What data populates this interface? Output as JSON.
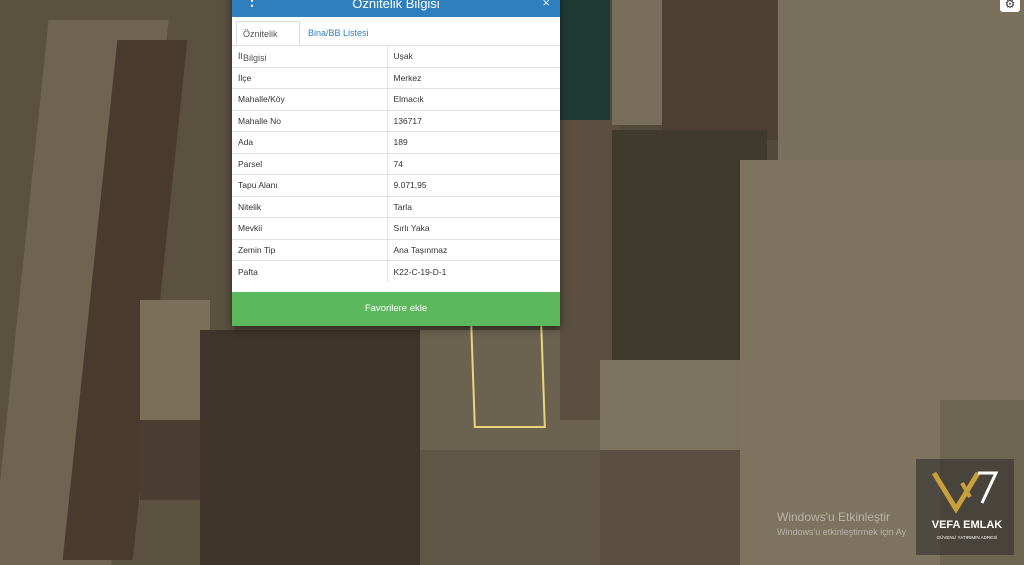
{
  "panel": {
    "title": "Öznitelik Bilgisi",
    "close": "×",
    "tabs": [
      {
        "label": "Öznitelik Bilgisi",
        "active": true
      },
      {
        "label": "Bina/BB Listesi",
        "active": false
      }
    ],
    "rows": [
      {
        "key": "İl",
        "value": "Uşak"
      },
      {
        "key": "İlçe",
        "value": "Merkez"
      },
      {
        "key": "Mahalle/Köy",
        "value": "Elmacık"
      },
      {
        "key": "Mahalle No",
        "value": "136717"
      },
      {
        "key": "Ada",
        "value": "189"
      },
      {
        "key": "Parsel",
        "value": "74"
      },
      {
        "key": "Tapu Alanı",
        "value": "9.071,95"
      },
      {
        "key": "Nitelik",
        "value": "Tarla"
      },
      {
        "key": "Mevkii",
        "value": "Sırlı Yaka"
      },
      {
        "key": "Zemin Tip",
        "value": "Ana Taşınmaz"
      },
      {
        "key": "Pafta",
        "value": "K22-C-19-D-1"
      }
    ],
    "favorite_button": "Favorilere ekle"
  },
  "watermark": {
    "line1": "Windows'u Etkinleştir",
    "line2": "Windows'u etkinleştirmek için Ay"
  },
  "logo": {
    "name": "VEFA EMLAK",
    "tagline": "GÜVENLİ YATIRIMIN ADRESİ"
  },
  "colors": {
    "header": "#2f7fbf",
    "button": "#5cb85c",
    "parcel_outline": "#e7d77a"
  },
  "icons": {
    "menu": "vertical-dots-icon",
    "settings": "gear-icon",
    "close": "close-icon"
  }
}
